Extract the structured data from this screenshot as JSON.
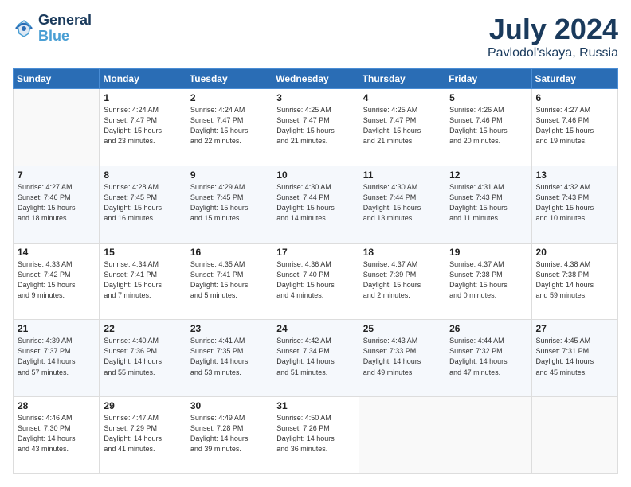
{
  "header": {
    "logo_line1": "General",
    "logo_line2": "Blue",
    "title": "July 2024",
    "subtitle": "Pavlodol'skaya, Russia"
  },
  "calendar": {
    "days_of_week": [
      "Sunday",
      "Monday",
      "Tuesday",
      "Wednesday",
      "Thursday",
      "Friday",
      "Saturday"
    ],
    "weeks": [
      [
        {
          "day": "",
          "info": ""
        },
        {
          "day": "1",
          "info": "Sunrise: 4:24 AM\nSunset: 7:47 PM\nDaylight: 15 hours\nand 23 minutes."
        },
        {
          "day": "2",
          "info": "Sunrise: 4:24 AM\nSunset: 7:47 PM\nDaylight: 15 hours\nand 22 minutes."
        },
        {
          "day": "3",
          "info": "Sunrise: 4:25 AM\nSunset: 7:47 PM\nDaylight: 15 hours\nand 21 minutes."
        },
        {
          "day": "4",
          "info": "Sunrise: 4:25 AM\nSunset: 7:47 PM\nDaylight: 15 hours\nand 21 minutes."
        },
        {
          "day": "5",
          "info": "Sunrise: 4:26 AM\nSunset: 7:46 PM\nDaylight: 15 hours\nand 20 minutes."
        },
        {
          "day": "6",
          "info": "Sunrise: 4:27 AM\nSunset: 7:46 PM\nDaylight: 15 hours\nand 19 minutes."
        }
      ],
      [
        {
          "day": "7",
          "info": "Sunrise: 4:27 AM\nSunset: 7:46 PM\nDaylight: 15 hours\nand 18 minutes."
        },
        {
          "day": "8",
          "info": "Sunrise: 4:28 AM\nSunset: 7:45 PM\nDaylight: 15 hours\nand 16 minutes."
        },
        {
          "day": "9",
          "info": "Sunrise: 4:29 AM\nSunset: 7:45 PM\nDaylight: 15 hours\nand 15 minutes."
        },
        {
          "day": "10",
          "info": "Sunrise: 4:30 AM\nSunset: 7:44 PM\nDaylight: 15 hours\nand 14 minutes."
        },
        {
          "day": "11",
          "info": "Sunrise: 4:30 AM\nSunset: 7:44 PM\nDaylight: 15 hours\nand 13 minutes."
        },
        {
          "day": "12",
          "info": "Sunrise: 4:31 AM\nSunset: 7:43 PM\nDaylight: 15 hours\nand 11 minutes."
        },
        {
          "day": "13",
          "info": "Sunrise: 4:32 AM\nSunset: 7:43 PM\nDaylight: 15 hours\nand 10 minutes."
        }
      ],
      [
        {
          "day": "14",
          "info": "Sunrise: 4:33 AM\nSunset: 7:42 PM\nDaylight: 15 hours\nand 9 minutes."
        },
        {
          "day": "15",
          "info": "Sunrise: 4:34 AM\nSunset: 7:41 PM\nDaylight: 15 hours\nand 7 minutes."
        },
        {
          "day": "16",
          "info": "Sunrise: 4:35 AM\nSunset: 7:41 PM\nDaylight: 15 hours\nand 5 minutes."
        },
        {
          "day": "17",
          "info": "Sunrise: 4:36 AM\nSunset: 7:40 PM\nDaylight: 15 hours\nand 4 minutes."
        },
        {
          "day": "18",
          "info": "Sunrise: 4:37 AM\nSunset: 7:39 PM\nDaylight: 15 hours\nand 2 minutes."
        },
        {
          "day": "19",
          "info": "Sunrise: 4:37 AM\nSunset: 7:38 PM\nDaylight: 15 hours\nand 0 minutes."
        },
        {
          "day": "20",
          "info": "Sunrise: 4:38 AM\nSunset: 7:38 PM\nDaylight: 14 hours\nand 59 minutes."
        }
      ],
      [
        {
          "day": "21",
          "info": "Sunrise: 4:39 AM\nSunset: 7:37 PM\nDaylight: 14 hours\nand 57 minutes."
        },
        {
          "day": "22",
          "info": "Sunrise: 4:40 AM\nSunset: 7:36 PM\nDaylight: 14 hours\nand 55 minutes."
        },
        {
          "day": "23",
          "info": "Sunrise: 4:41 AM\nSunset: 7:35 PM\nDaylight: 14 hours\nand 53 minutes."
        },
        {
          "day": "24",
          "info": "Sunrise: 4:42 AM\nSunset: 7:34 PM\nDaylight: 14 hours\nand 51 minutes."
        },
        {
          "day": "25",
          "info": "Sunrise: 4:43 AM\nSunset: 7:33 PM\nDaylight: 14 hours\nand 49 minutes."
        },
        {
          "day": "26",
          "info": "Sunrise: 4:44 AM\nSunset: 7:32 PM\nDaylight: 14 hours\nand 47 minutes."
        },
        {
          "day": "27",
          "info": "Sunrise: 4:45 AM\nSunset: 7:31 PM\nDaylight: 14 hours\nand 45 minutes."
        }
      ],
      [
        {
          "day": "28",
          "info": "Sunrise: 4:46 AM\nSunset: 7:30 PM\nDaylight: 14 hours\nand 43 minutes."
        },
        {
          "day": "29",
          "info": "Sunrise: 4:47 AM\nSunset: 7:29 PM\nDaylight: 14 hours\nand 41 minutes."
        },
        {
          "day": "30",
          "info": "Sunrise: 4:49 AM\nSunset: 7:28 PM\nDaylight: 14 hours\nand 39 minutes."
        },
        {
          "day": "31",
          "info": "Sunrise: 4:50 AM\nSunset: 7:26 PM\nDaylight: 14 hours\nand 36 minutes."
        },
        {
          "day": "",
          "info": ""
        },
        {
          "day": "",
          "info": ""
        },
        {
          "day": "",
          "info": ""
        }
      ]
    ]
  }
}
